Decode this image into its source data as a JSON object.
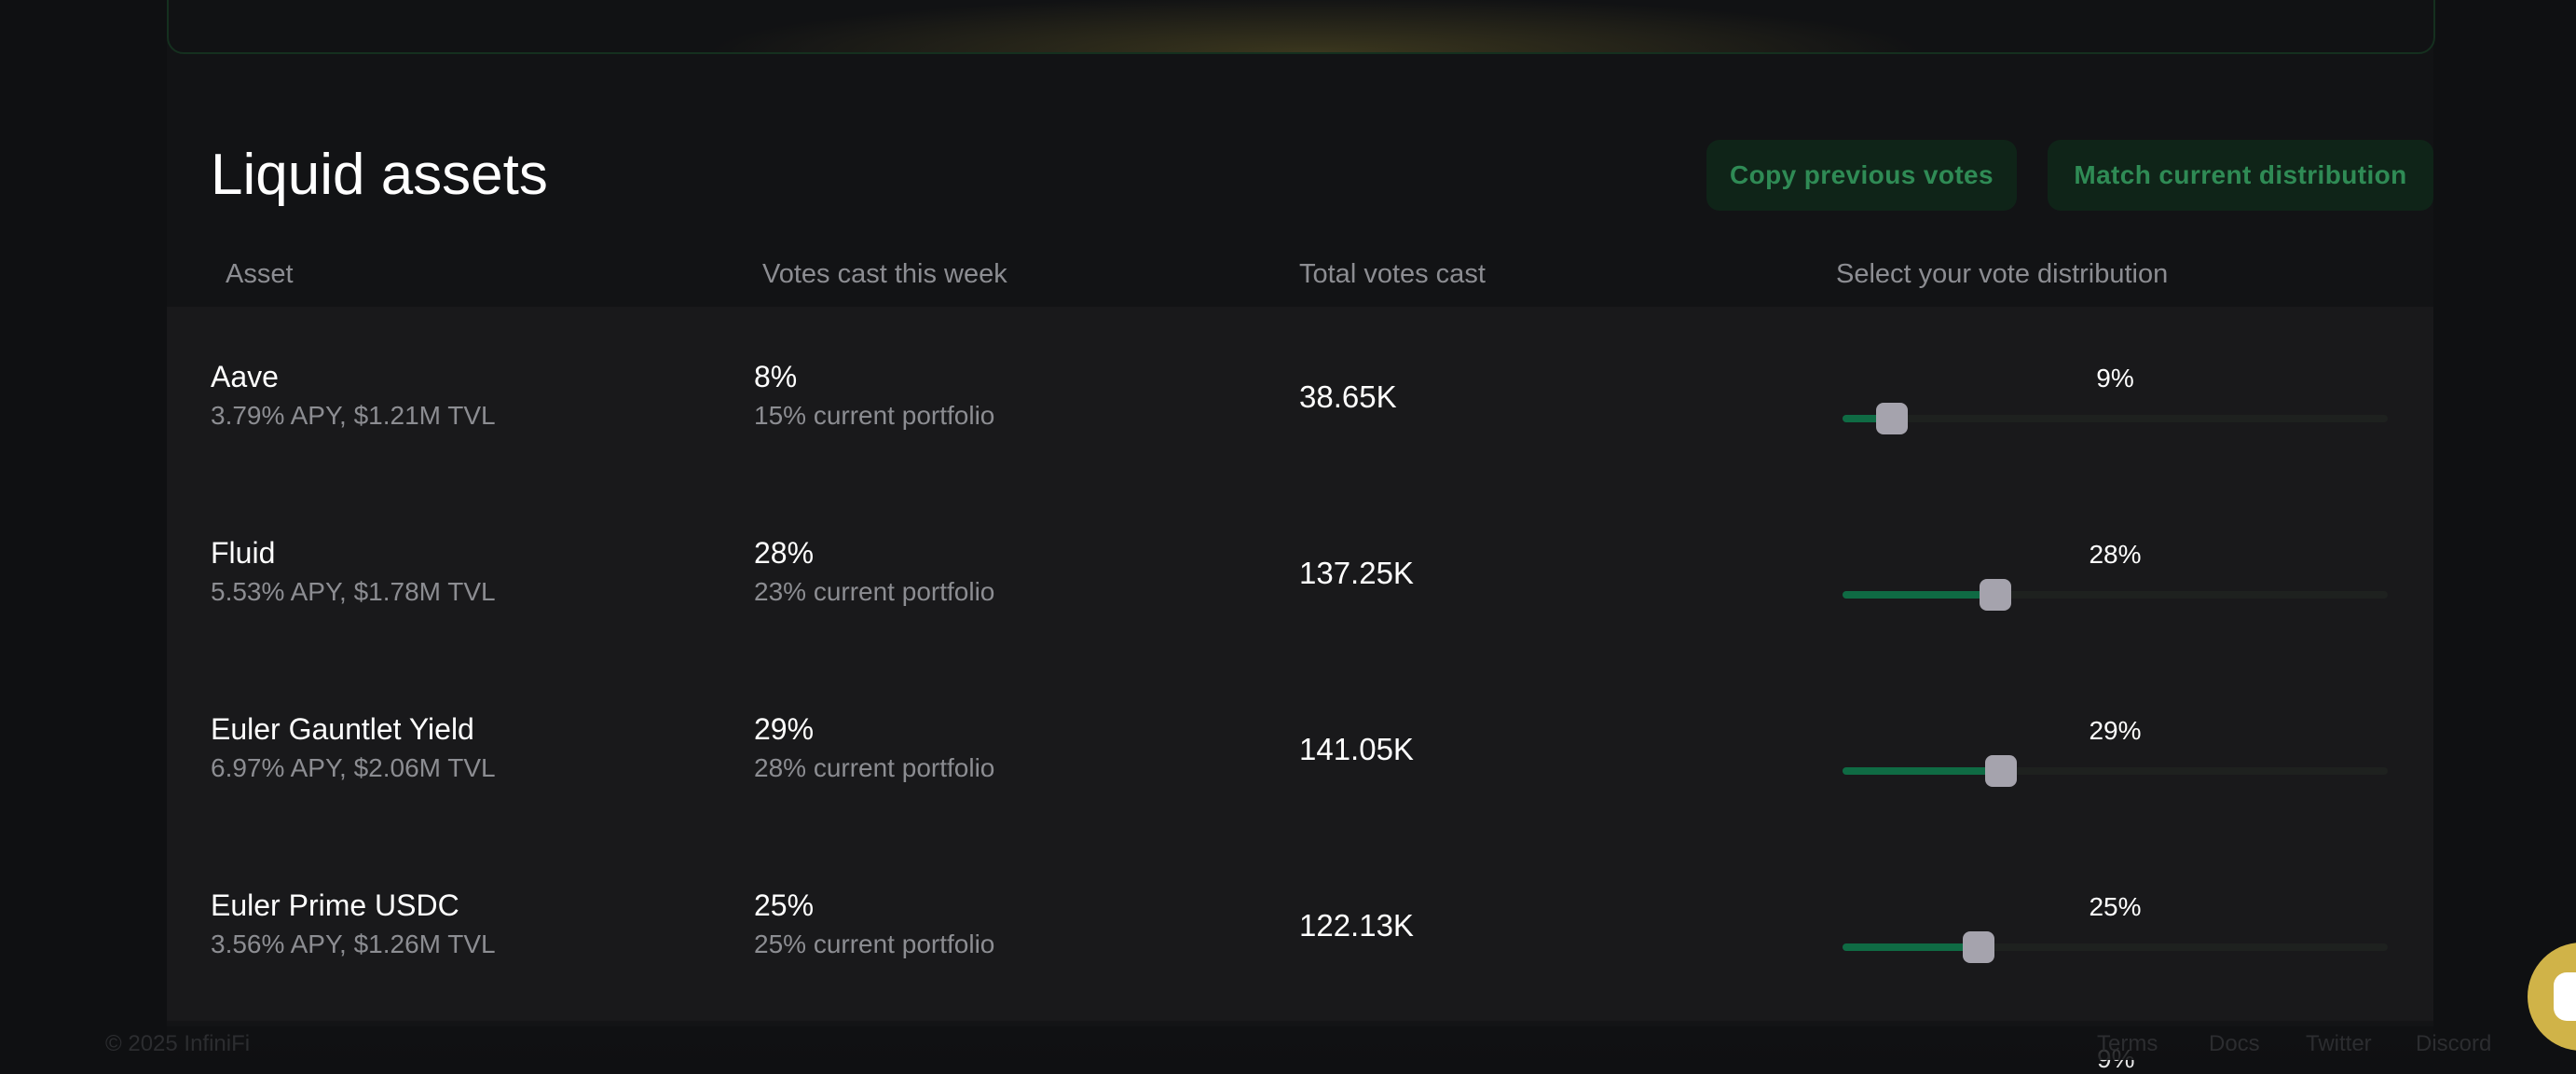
{
  "section": {
    "title": "Liquid assets",
    "copy_votes_label": "Copy previous votes",
    "match_distribution_label": "Match current distribution"
  },
  "columns": {
    "asset": "Asset",
    "votes_week": "Votes cast this week",
    "total_votes": "Total votes cast",
    "distribution": "Select your vote distribution"
  },
  "rows": [
    {
      "name": "Aave",
      "stats": "3.79% APY, $1.21M TVL",
      "week_pct": "8%",
      "current_portfolio": "15% current portfolio",
      "total": "38.65K",
      "vote_label": "9%",
      "vote_value": 9
    },
    {
      "name": "Fluid",
      "stats": "5.53% APY, $1.78M TVL",
      "week_pct": "28%",
      "current_portfolio": "23% current portfolio",
      "total": "137.25K",
      "vote_label": "28%",
      "vote_value": 28
    },
    {
      "name": "Euler Gauntlet Yield",
      "stats": "6.97% APY, $2.06M TVL",
      "week_pct": "29%",
      "current_portfolio": "28% current portfolio",
      "total": "141.05K",
      "vote_label": "29%",
      "vote_value": 29
    },
    {
      "name": "Euler Prime USDC",
      "stats": "3.56% APY, $1.26M TVL",
      "week_pct": "25%",
      "current_portfolio": "25% current portfolio",
      "total": "122.13K",
      "vote_label": "25%",
      "vote_value": 25
    }
  ],
  "partial_row_vote_label": "9%",
  "footer": {
    "copyright": "© 2025 InfiniFi",
    "links": [
      "Terms",
      "Docs",
      "Twitter",
      "Discord"
    ]
  },
  "colors": {
    "accent_green": "#0f6b44",
    "button_text": "#2f8b55",
    "chat_bubble": "#d0b348"
  },
  "icons": {
    "chat": "chat-bubble-icon"
  }
}
